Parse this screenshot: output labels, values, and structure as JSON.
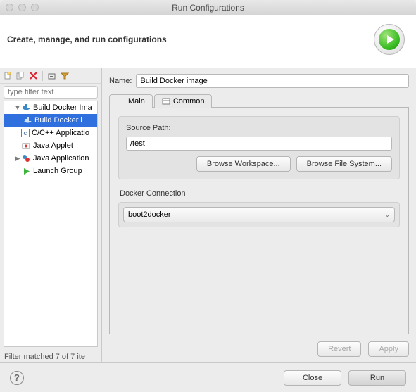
{
  "window": {
    "title": "Run Configurations"
  },
  "header": {
    "heading": "Create, manage, and run configurations"
  },
  "filter": {
    "placeholder": "type filter text"
  },
  "tree": {
    "items": [
      {
        "label": "Build Docker Ima",
        "icon": "docker"
      },
      {
        "label": "Build Docker i",
        "icon": "docker",
        "selected": true
      },
      {
        "label": "C/C++ Applicatio",
        "icon": "c"
      },
      {
        "label": "Java Applet",
        "icon": "java"
      },
      {
        "label": "Java Application",
        "icon": "java"
      },
      {
        "label": "Launch Group",
        "icon": "play"
      }
    ]
  },
  "status": {
    "text": "Filter matched 7 of 7 ite"
  },
  "name": {
    "label": "Name:",
    "value": "Build Docker image"
  },
  "tabs": {
    "main": "Main",
    "common": "Common"
  },
  "main": {
    "sourcePath": {
      "label": "Source Path:",
      "value": "/test"
    },
    "browseWorkspace": "Browse Workspace...",
    "browseFileSystem": "Browse File System...",
    "dockerConnection": {
      "label": "Docker Connection",
      "value": "boot2docker"
    }
  },
  "actions": {
    "revert": "Revert",
    "apply": "Apply"
  },
  "footer": {
    "close": "Close",
    "run": "Run"
  }
}
